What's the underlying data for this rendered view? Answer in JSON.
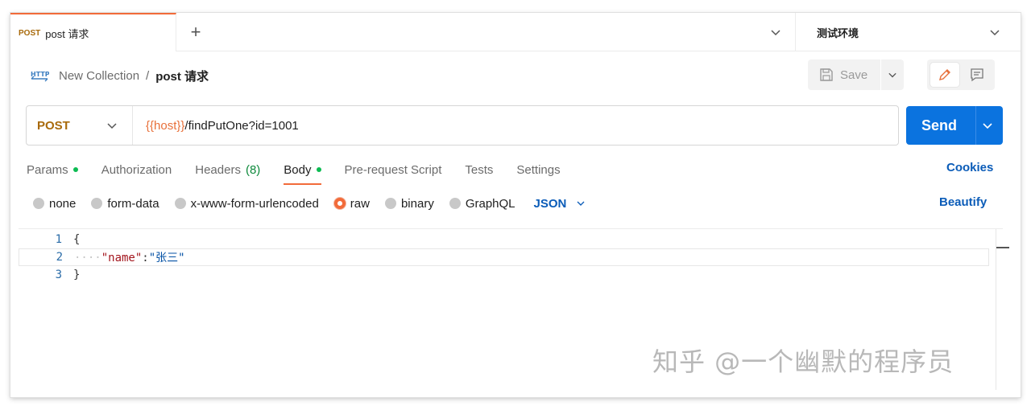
{
  "tabs": {
    "active": {
      "method": "POST",
      "title": "post 请求"
    },
    "new_tab_symbol": "+"
  },
  "environment": {
    "label": "测试环境"
  },
  "breadcrumb": {
    "collection": "New Collection",
    "separator": "/",
    "current": "post 请求"
  },
  "toolbar": {
    "save_label": "Save"
  },
  "request": {
    "method": "POST",
    "url_variable": "{{host}}",
    "url_rest": "/findPutOne?id=1001",
    "send_label": "Send"
  },
  "request_tabs": {
    "params": "Params",
    "authorization": "Authorization",
    "headers": "Headers",
    "headers_count": "(8)",
    "body": "Body",
    "pre_request": "Pre-request Script",
    "tests": "Tests",
    "settings": "Settings",
    "cookies": "Cookies"
  },
  "body_options": {
    "none": "none",
    "form_data": "form-data",
    "urlencoded": "x-www-form-urlencoded",
    "raw": "raw",
    "binary": "binary",
    "graphql": "GraphQL",
    "language": "JSON",
    "beautify": "Beautify"
  },
  "editor": {
    "lines": [
      {
        "num": "1",
        "text": "{"
      },
      {
        "num": "2",
        "indent": "····",
        "key": "\"name\"",
        "colon": ":",
        "value": "\"张三\""
      },
      {
        "num": "3",
        "text": "}"
      }
    ]
  },
  "watermark": "知乎 @一个幽默的程序员",
  "colors": {
    "accent": "#f26b3a",
    "send": "#0b73df",
    "link": "#0b5cb8",
    "method": "#a86a0b",
    "dot": "#0cbb52"
  }
}
